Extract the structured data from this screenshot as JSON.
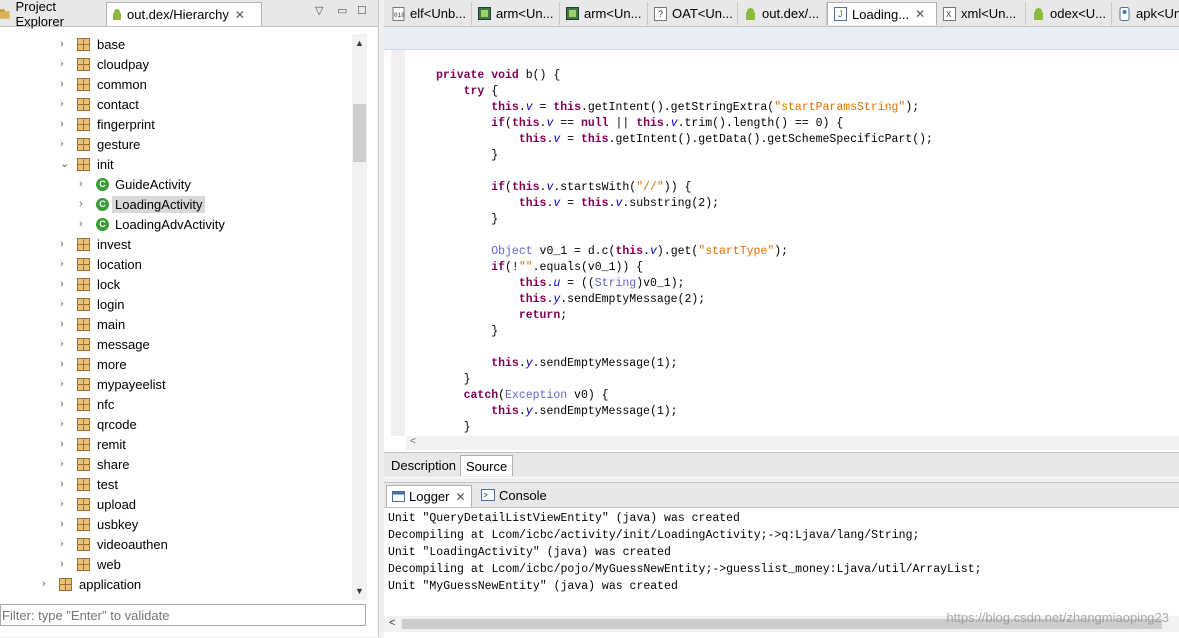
{
  "left_panel": {
    "tab_project": "Project Explorer",
    "tab_hierarchy": "out.dex/Hierarchy",
    "tree": [
      {
        "label": "base",
        "type": "package",
        "depth": 1,
        "expanded": false
      },
      {
        "label": "cloudpay",
        "type": "package",
        "depth": 1,
        "expanded": false
      },
      {
        "label": "common",
        "type": "package",
        "depth": 1,
        "expanded": false
      },
      {
        "label": "contact",
        "type": "package",
        "depth": 1,
        "expanded": false
      },
      {
        "label": "fingerprint",
        "type": "package",
        "depth": 1,
        "expanded": false
      },
      {
        "label": "gesture",
        "type": "package",
        "depth": 1,
        "expanded": false
      },
      {
        "label": "init",
        "type": "package",
        "depth": 1,
        "expanded": true
      },
      {
        "label": "GuideActivity",
        "type": "class",
        "depth": 2,
        "expanded": false
      },
      {
        "label": "LoadingActivity",
        "type": "class",
        "depth": 2,
        "expanded": false,
        "selected": true
      },
      {
        "label": "LoadingAdvActivity",
        "type": "class",
        "depth": 2,
        "expanded": false
      },
      {
        "label": "invest",
        "type": "package",
        "depth": 1,
        "expanded": false
      },
      {
        "label": "location",
        "type": "package",
        "depth": 1,
        "expanded": false
      },
      {
        "label": "lock",
        "type": "package",
        "depth": 1,
        "expanded": false
      },
      {
        "label": "login",
        "type": "package",
        "depth": 1,
        "expanded": false
      },
      {
        "label": "main",
        "type": "package",
        "depth": 1,
        "expanded": false
      },
      {
        "label": "message",
        "type": "package",
        "depth": 1,
        "expanded": false
      },
      {
        "label": "more",
        "type": "package",
        "depth": 1,
        "expanded": false
      },
      {
        "label": "mypayeelist",
        "type": "package",
        "depth": 1,
        "expanded": false
      },
      {
        "label": "nfc",
        "type": "package",
        "depth": 1,
        "expanded": false
      },
      {
        "label": "qrcode",
        "type": "package",
        "depth": 1,
        "expanded": false
      },
      {
        "label": "remit",
        "type": "package",
        "depth": 1,
        "expanded": false
      },
      {
        "label": "share",
        "type": "package",
        "depth": 1,
        "expanded": false
      },
      {
        "label": "test",
        "type": "package",
        "depth": 1,
        "expanded": false
      },
      {
        "label": "upload",
        "type": "package",
        "depth": 1,
        "expanded": false
      },
      {
        "label": "usbkey",
        "type": "package",
        "depth": 1,
        "expanded": false
      },
      {
        "label": "videoauthen",
        "type": "package",
        "depth": 1,
        "expanded": false
      },
      {
        "label": "web",
        "type": "package",
        "depth": 1,
        "expanded": false
      },
      {
        "label": "application",
        "type": "package",
        "depth": 0,
        "expanded": false
      }
    ],
    "filter_placeholder": "Filter: type \"Enter\" to validate"
  },
  "editor": {
    "tabs": [
      {
        "label": "elf<Unb...",
        "icon": "binary-file-icon"
      },
      {
        "label": "arm<Un...",
        "icon": "chip-icon"
      },
      {
        "label": "arm<Un...",
        "icon": "chip-icon"
      },
      {
        "label": "OAT<Un...",
        "icon": "unknown-file-icon"
      },
      {
        "label": "out.dex/...",
        "icon": "android-icon"
      },
      {
        "label": "Loading...",
        "icon": "java-file-icon",
        "active": true
      },
      {
        "label": "xml<Un...",
        "icon": "xml-file-icon"
      },
      {
        "label": "odex<U...",
        "icon": "android-icon"
      },
      {
        "label": "apk<Un",
        "icon": "apk-icon"
      }
    ],
    "code_lines": [
      [
        {
          "t": "private void ",
          "c": "kw"
        },
        {
          "t": "b() {",
          "c": ""
        }
      ],
      [
        {
          "t": "    ",
          "c": ""
        },
        {
          "t": "try",
          "c": "kw"
        },
        {
          "t": " {",
          "c": ""
        }
      ],
      [
        {
          "t": "        ",
          "c": ""
        },
        {
          "t": "this",
          "c": "kw"
        },
        {
          "t": ".",
          "c": ""
        },
        {
          "t": "v",
          "c": "it"
        },
        {
          "t": " = ",
          "c": ""
        },
        {
          "t": "this",
          "c": "kw"
        },
        {
          "t": ".getIntent().getStringExtra(",
          "c": ""
        },
        {
          "t": "\"startParamsString\"",
          "c": "st"
        },
        {
          "t": ");",
          "c": ""
        }
      ],
      [
        {
          "t": "        ",
          "c": ""
        },
        {
          "t": "if",
          "c": "kw"
        },
        {
          "t": "(",
          "c": ""
        },
        {
          "t": "this",
          "c": "kw"
        },
        {
          "t": ".",
          "c": ""
        },
        {
          "t": "v",
          "c": "it"
        },
        {
          "t": " == ",
          "c": ""
        },
        {
          "t": "null",
          "c": "kw"
        },
        {
          "t": " || ",
          "c": ""
        },
        {
          "t": "this",
          "c": "kw"
        },
        {
          "t": ".",
          "c": ""
        },
        {
          "t": "v",
          "c": "it"
        },
        {
          "t": ".trim().length() == 0) {",
          "c": ""
        }
      ],
      [
        {
          "t": "            ",
          "c": ""
        },
        {
          "t": "this",
          "c": "kw"
        },
        {
          "t": ".",
          "c": ""
        },
        {
          "t": "v",
          "c": "it"
        },
        {
          "t": " = ",
          "c": ""
        },
        {
          "t": "this",
          "c": "kw"
        },
        {
          "t": ".getIntent().getData().getSchemeSpecificPart();",
          "c": ""
        }
      ],
      [
        {
          "t": "        }",
          "c": ""
        }
      ],
      [
        {
          "t": "",
          "c": ""
        }
      ],
      [
        {
          "t": "        ",
          "c": ""
        },
        {
          "t": "if",
          "c": "kw"
        },
        {
          "t": "(",
          "c": ""
        },
        {
          "t": "this",
          "c": "kw"
        },
        {
          "t": ".",
          "c": ""
        },
        {
          "t": "v",
          "c": "it"
        },
        {
          "t": ".startsWith(",
          "c": ""
        },
        {
          "t": "\"//\"",
          "c": "st"
        },
        {
          "t": ")) {",
          "c": ""
        }
      ],
      [
        {
          "t": "            ",
          "c": ""
        },
        {
          "t": "this",
          "c": "kw"
        },
        {
          "t": ".",
          "c": ""
        },
        {
          "t": "v",
          "c": "it"
        },
        {
          "t": " = ",
          "c": ""
        },
        {
          "t": "this",
          "c": "kw"
        },
        {
          "t": ".",
          "c": ""
        },
        {
          "t": "v",
          "c": "it"
        },
        {
          "t": ".substring(2);",
          "c": ""
        }
      ],
      [
        {
          "t": "        }",
          "c": ""
        }
      ],
      [
        {
          "t": "",
          "c": ""
        }
      ],
      [
        {
          "t": "        ",
          "c": ""
        },
        {
          "t": "Object",
          "c": "ty"
        },
        {
          "t": " v0_1 = d.c(",
          "c": ""
        },
        {
          "t": "this",
          "c": "kw"
        },
        {
          "t": ".",
          "c": ""
        },
        {
          "t": "v",
          "c": "it"
        },
        {
          "t": ").get(",
          "c": ""
        },
        {
          "t": "\"startType\"",
          "c": "st"
        },
        {
          "t": ");",
          "c": ""
        }
      ],
      [
        {
          "t": "        ",
          "c": ""
        },
        {
          "t": "if",
          "c": "kw"
        },
        {
          "t": "(!",
          "c": ""
        },
        {
          "t": "\"\"",
          "c": "st"
        },
        {
          "t": ".equals(v0_1)) {",
          "c": ""
        }
      ],
      [
        {
          "t": "            ",
          "c": ""
        },
        {
          "t": "this",
          "c": "kw"
        },
        {
          "t": ".",
          "c": ""
        },
        {
          "t": "u",
          "c": "it"
        },
        {
          "t": " = ((",
          "c": ""
        },
        {
          "t": "String",
          "c": "ty"
        },
        {
          "t": ")v0_1);",
          "c": ""
        }
      ],
      [
        {
          "t": "            ",
          "c": ""
        },
        {
          "t": "this",
          "c": "kw"
        },
        {
          "t": ".",
          "c": ""
        },
        {
          "t": "y",
          "c": "it"
        },
        {
          "t": ".sendEmptyMessage(2);",
          "c": ""
        }
      ],
      [
        {
          "t": "            ",
          "c": ""
        },
        {
          "t": "return",
          "c": "kw"
        },
        {
          "t": ";",
          "c": ""
        }
      ],
      [
        {
          "t": "        }",
          "c": ""
        }
      ],
      [
        {
          "t": "",
          "c": ""
        }
      ],
      [
        {
          "t": "        ",
          "c": ""
        },
        {
          "t": "this",
          "c": "kw"
        },
        {
          "t": ".",
          "c": ""
        },
        {
          "t": "y",
          "c": "it"
        },
        {
          "t": ".sendEmptyMessage(1);",
          "c": ""
        }
      ],
      [
        {
          "t": "    }",
          "c": ""
        }
      ],
      [
        {
          "t": "    ",
          "c": ""
        },
        {
          "t": "catch",
          "c": "kw"
        },
        {
          "t": "(",
          "c": ""
        },
        {
          "t": "Exception",
          "c": "ty"
        },
        {
          "t": " v0) {",
          "c": ""
        }
      ],
      [
        {
          "t": "        ",
          "c": ""
        },
        {
          "t": "this",
          "c": "kw"
        },
        {
          "t": ".",
          "c": ""
        },
        {
          "t": "y",
          "c": "it"
        },
        {
          "t": ".sendEmptyMessage(1);",
          "c": ""
        }
      ],
      [
        {
          "t": "    }",
          "c": ""
        }
      ]
    ],
    "bottom_tabs": {
      "description": "Description",
      "source": "Source"
    }
  },
  "logger": {
    "tab_logger": "Logger",
    "tab_console": "Console",
    "lines": [
      "Unit \"QueryDetailListViewEntity\" (java) was created",
      "Decompiling at Lcom/icbc/activity/init/LoadingActivity;->q:Ljava/lang/String;",
      "Unit \"LoadingActivity\" (java) was created",
      "Decompiling at Lcom/icbc/pojo/MyGuessNewEntity;->guesslist_money:Ljava/util/ArrayList;",
      "Unit \"MyGuessNewEntity\" (java) was created"
    ],
    "watermark": "https://blog.csdn.net/zhangmiaoping23"
  }
}
